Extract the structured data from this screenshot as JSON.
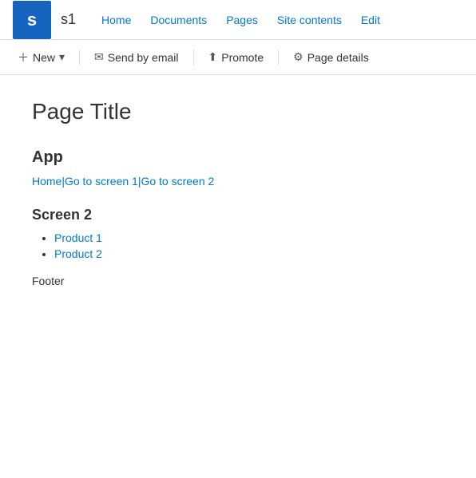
{
  "site": {
    "logo_letter": "s",
    "name": "s1"
  },
  "top_nav": {
    "items": [
      {
        "label": "Home",
        "href": "#"
      },
      {
        "label": "Documents",
        "href": "#"
      },
      {
        "label": "Pages",
        "href": "#"
      },
      {
        "label": "Site contents",
        "href": "#"
      },
      {
        "label": "Edit",
        "href": "#"
      }
    ]
  },
  "command_bar": {
    "new_label": "New",
    "new_dropdown_icon": "▾",
    "send_email_label": "Send by email",
    "promote_label": "Promote",
    "page_details_label": "Page details"
  },
  "page": {
    "title": "Page Title"
  },
  "app": {
    "heading": "App",
    "breadcrumbs": [
      {
        "label": "Home",
        "href": "#"
      },
      {
        "label": "|Go to screen 1",
        "href": "#"
      },
      {
        "label": " |Go to screen 2",
        "href": "#"
      }
    ]
  },
  "screen2": {
    "heading": "Screen 2",
    "products": [
      {
        "label": "Product 1",
        "href": "#"
      },
      {
        "label": "Product 2",
        "href": "#"
      }
    ]
  },
  "footer": {
    "text": "Footer"
  }
}
